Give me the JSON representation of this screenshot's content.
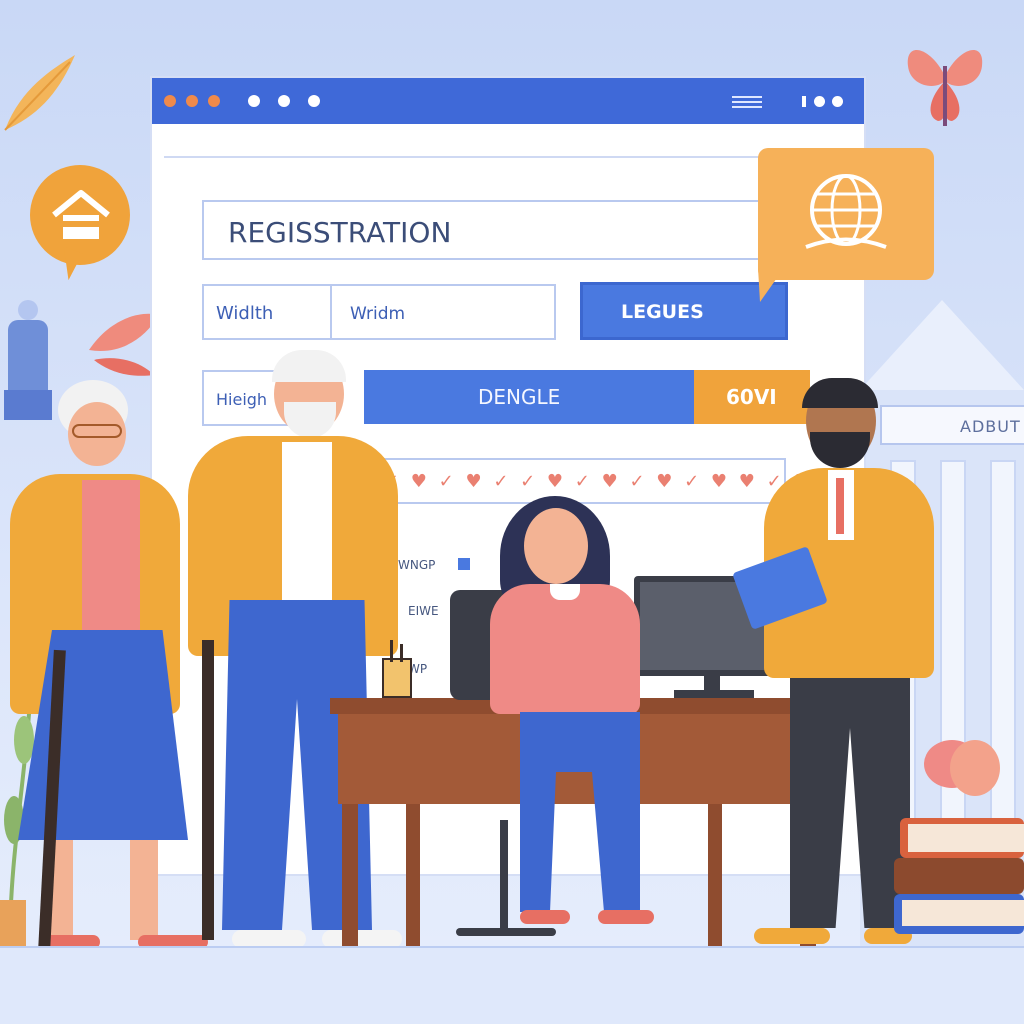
{
  "window": {
    "controls": [
      "orange-dot",
      "orange-dot",
      "orange-dot",
      "white-dot",
      "white-dot",
      "white-dot"
    ],
    "menu_icon": "hamburger-icon"
  },
  "form": {
    "title": "REGISSTRATION",
    "width_label": "Widlth",
    "width_value": "Wridm",
    "leagues_button": "LEGUES",
    "height_label": "Hieigh",
    "dengle_button": "DENGLE",
    "dengle_badge": "60VI",
    "check_marks": "✓ ♥ ✓ ♥ ✓ ✓ ♥ ✓ ♥ ✓ ♥ ✓ ♥ ♥ ✓ ♥",
    "side_labels": [
      "WNGP",
      "EIWE",
      "WP"
    ]
  },
  "background": {
    "building_sign": "ADBUT"
  },
  "icons": {
    "home": "home-icon",
    "globe": "globe-icon",
    "butterfly": "butterfly-icon",
    "leaf": "leaf-icon"
  },
  "colors": {
    "titlebar": "#3f69d8",
    "accent_orange": "#f0a33b",
    "button_blue": "#4a79e0",
    "field_border": "#b9c9ef"
  }
}
